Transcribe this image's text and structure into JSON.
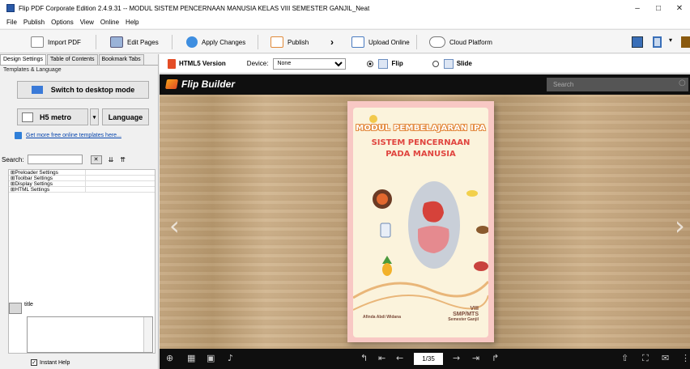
{
  "window": {
    "title": "Flip PDF Corporate Edition 2.4.9.31 -- MODUL SISTEM PENCERNAAN MANUSIA KELAS VIII SEMESTER GANJIL_Neat",
    "minimize": "–",
    "maximize": "□",
    "close": "✕"
  },
  "menu": [
    "File",
    "Publish",
    "Options",
    "View",
    "Online",
    "Help"
  ],
  "toolbar": {
    "import_pdf": "Import PDF",
    "edit_pages": "Edit Pages",
    "apply_changes": "Apply Changes",
    "publish": "Publish",
    "upload_online": "Upload Online",
    "cloud_platform": "Cloud Platform"
  },
  "left_panel": {
    "tabs": [
      "Design Settings",
      "Table of Contents",
      "Bookmark Tabs"
    ],
    "group_label": "Templates & Language",
    "switch_desktop": "Switch to desktop mode",
    "template_name": "H5 metro",
    "language": "Language",
    "templates_link": "Get more free online templates here...",
    "search_label": "Search:",
    "settings": [
      "⊞Preloader Settings",
      "⊞Toolbar Settings",
      "⊞Display Settings",
      "⊞HTML Settings"
    ],
    "help_title": "title",
    "instant_help": "Instant Help"
  },
  "subbar": {
    "html5_version": "HTML5 Version",
    "device_label": "Device:",
    "device_value": "None",
    "flip_label": "Flip",
    "slide_label": "Slide"
  },
  "viewer": {
    "brand": "Flip Builder",
    "search_placeholder": "Search",
    "page_indicator": "1/35"
  },
  "book_cover": {
    "title": "MODUL PEMBELAJARAN IPA",
    "subtitle_line1": "SISTEM PENCERNAAN",
    "subtitle_line2": "PADA MANUSIA",
    "author": "Afinda Abdi Widana",
    "grade": "VIII",
    "school": "SMP/MTS",
    "semester": "Semester Ganjil"
  },
  "colors": {
    "cover_pink": "#f8c8c4",
    "cover_cream": "#fbf3dc",
    "subtitle_red": "#e0453f",
    "viewer_black": "#0f0f0f"
  }
}
